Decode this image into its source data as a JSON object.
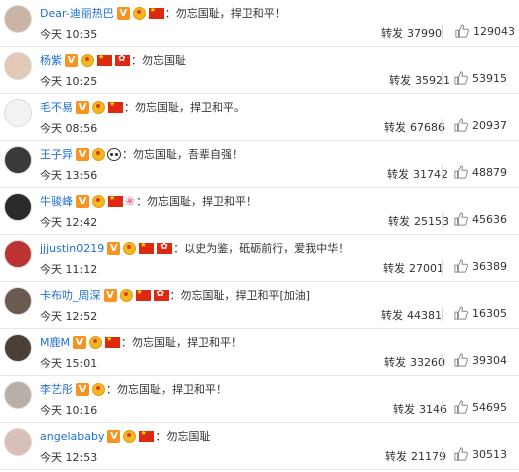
{
  "labels": {
    "repost_prefix": "转发"
  },
  "rows": [
    {
      "name": "Dear-迪丽热巴",
      "badges": [
        "v",
        "medal",
        "cn"
      ],
      "comment": "：勿忘国耻，捍卫和平！",
      "time": "今天 10:35",
      "reposts": "37990",
      "likes": "129043"
    },
    {
      "name": "杨紫",
      "badges": [
        "v",
        "medal",
        "cn",
        "hk"
      ],
      "comment": "：勿忘国耻",
      "time": "今天 10:25",
      "reposts": "35921",
      "likes": "53915"
    },
    {
      "name": "毛不易",
      "badges": [
        "v",
        "medal",
        "cn"
      ],
      "comment": "：勿忘国耻，捍卫和平。",
      "time": "今天 08:56",
      "reposts": "67686",
      "likes": "20937"
    },
    {
      "name": "王子异",
      "badges": [
        "v",
        "medal",
        "panda"
      ],
      "comment": "：勿忘国耻，吾辈自强！",
      "time": "今天 13:56",
      "reposts": "31742",
      "likes": "48879"
    },
    {
      "name": "牛骏峰",
      "badges": [
        "v",
        "medal",
        "cn",
        "flower"
      ],
      "comment": "：勿忘国耻，捍卫和平！",
      "time": "今天 12:42",
      "reposts": "25153",
      "likes": "45636"
    },
    {
      "name": "jjjustin0219",
      "badges": [
        "v",
        "medal",
        "cn",
        "hk"
      ],
      "comment": "：以史为鉴，砥砺前行，爱我中华！",
      "time": "今天 11:12",
      "reposts": "27001",
      "likes": "36389"
    },
    {
      "name": "卡布叻_周深",
      "badges": [
        "v",
        "medal",
        "cn",
        "hk"
      ],
      "comment": "：勿忘国耻，捍卫和平[加油]",
      "time": "今天 12:52",
      "reposts": "44381",
      "likes": "16305"
    },
    {
      "name": "M鹿M",
      "badges": [
        "v",
        "medal",
        "cn"
      ],
      "comment": "：勿忘国耻，捍卫和平！",
      "time": "今天 15:01",
      "reposts": "33260",
      "likes": "39304"
    },
    {
      "name": "李艺彤",
      "badges": [
        "v",
        "medal"
      ],
      "comment": "：勿忘国耻，捍卫和平！",
      "time": "今天 10:16",
      "reposts": "3146",
      "likes": "54695"
    },
    {
      "name": "angelababy",
      "badges": [
        "v",
        "medal",
        "cn"
      ],
      "comment": "：勿忘国耻",
      "time": "今天 12:53",
      "reposts": "21179",
      "likes": "30513"
    }
  ],
  "colors": {
    "name_link": "#1f6ed4",
    "verified_badge": "#f7931e",
    "divider": "#e6e6e6"
  },
  "icons": {
    "like": "thumbs-up-icon",
    "verified": "verified-v-icon",
    "medal": "medal-icon",
    "flag_cn": "china-flag-icon",
    "flag_hk": "hong-kong-flag-icon"
  }
}
